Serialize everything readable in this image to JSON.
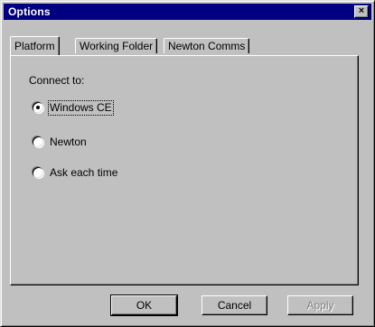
{
  "window": {
    "title": "Options",
    "close_glyph": "×"
  },
  "tabs": [
    {
      "label": "Platform",
      "active": true
    },
    {
      "label": "Working Folder",
      "active": false
    },
    {
      "label": "Newton Comms",
      "active": false
    }
  ],
  "platform": {
    "group_label": "Connect to:",
    "options": [
      {
        "label": "Windows CE",
        "selected": true
      },
      {
        "label": "Newton",
        "selected": false
      },
      {
        "label": "Ask each time",
        "selected": false
      }
    ]
  },
  "buttons": {
    "ok": "OK",
    "cancel": "Cancel",
    "apply": "Apply"
  },
  "colors": {
    "titlebar": "#000080",
    "face": "#c0c0c0"
  }
}
